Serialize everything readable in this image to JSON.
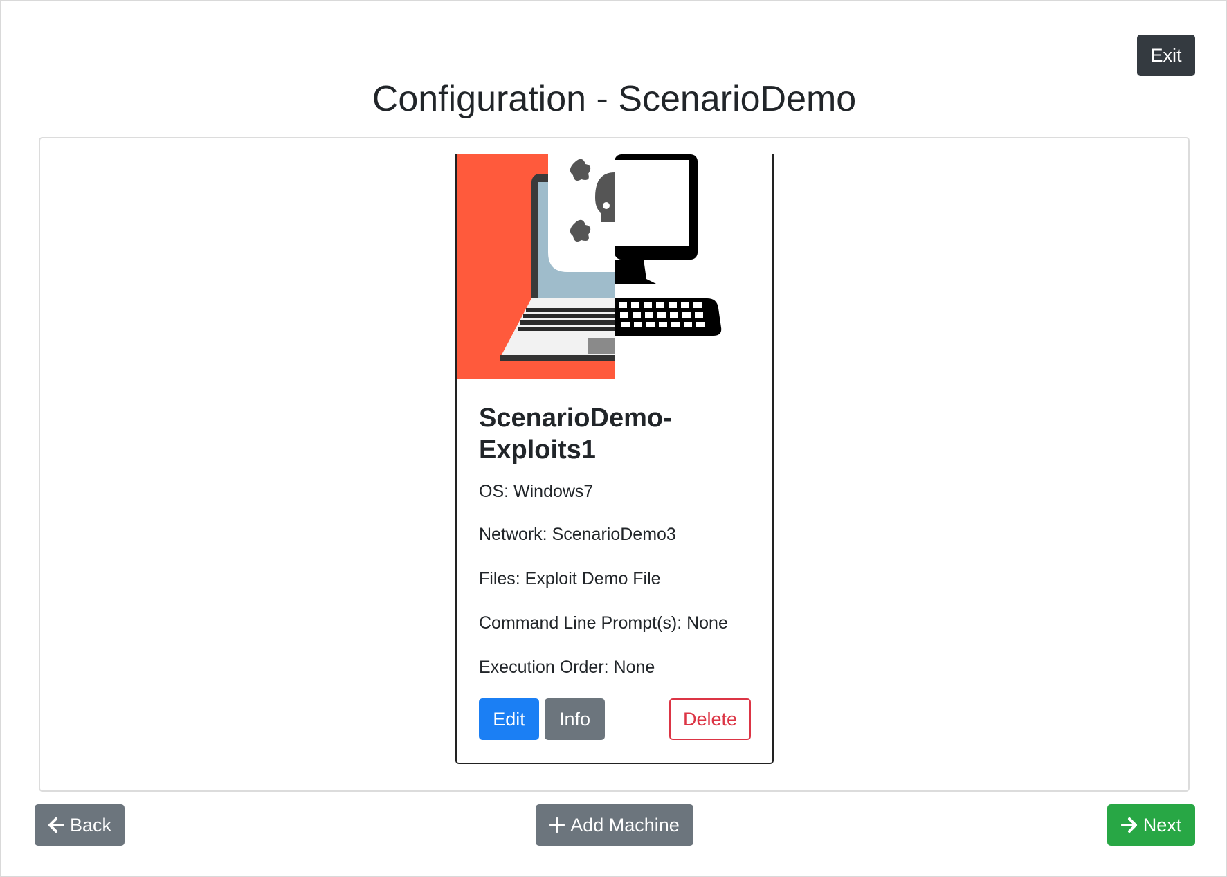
{
  "header": {
    "exit_label": "Exit",
    "title": "Configuration - ScenarioDemo"
  },
  "machine_card": {
    "name": "ScenarioDemo-Exploits1",
    "image": "exploit-machine-illustration",
    "os_line": "OS: Windows7",
    "network_line": "Network: ScenarioDemo3",
    "files_line": "Files: Exploit Demo File",
    "prompts_line": "Command Line Prompt(s): None",
    "order_line": "Execution Order: None",
    "edit_label": "Edit",
    "info_label": "Info",
    "delete_label": "Delete"
  },
  "footer": {
    "back_label": "Back",
    "back_icon": "arrow-left-icon",
    "add_machine_label": "Add Machine",
    "add_machine_icon": "plus-icon",
    "next_label": "Next",
    "next_icon": "arrow-right-icon"
  },
  "colors": {
    "primary": "#1b7ff4",
    "secondary": "#6c757d",
    "success": "#28a745",
    "danger": "#dc3545",
    "dark": "#343a40",
    "image_accent": "#ff5a3c"
  }
}
